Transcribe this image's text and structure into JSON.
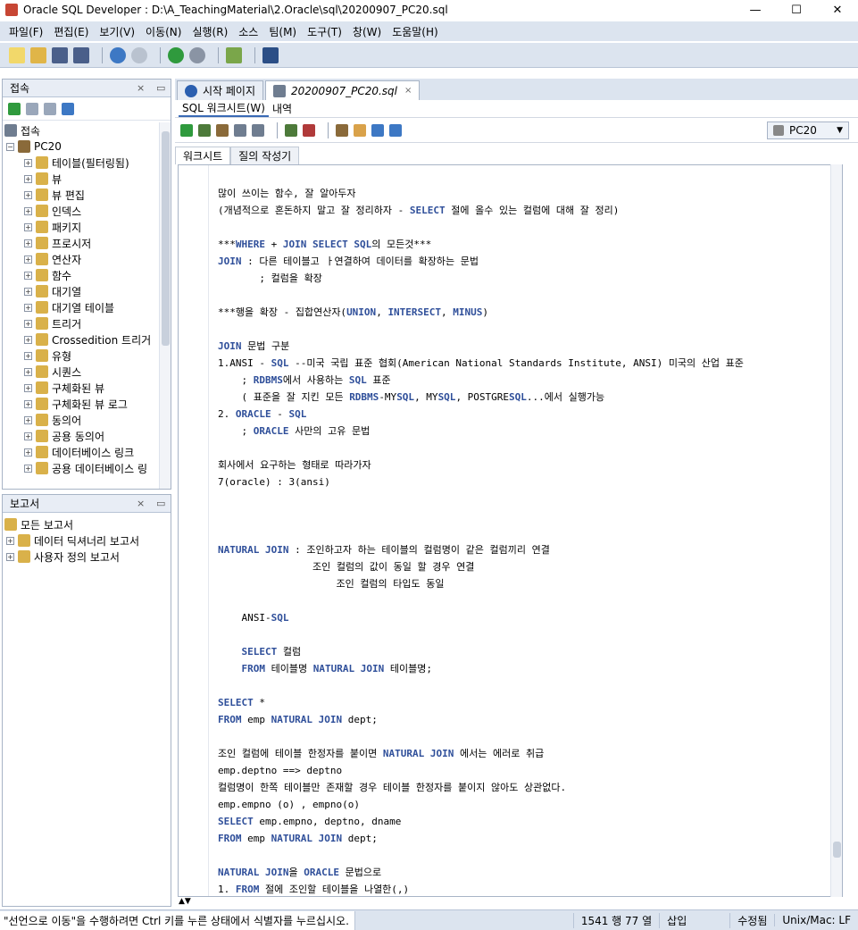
{
  "window": {
    "title": "Oracle SQL Developer : D:\\A_TeachingMaterial\\2.Oracle\\sql\\20200907_PC20.sql",
    "minimize_glyph": "—",
    "maximize_glyph": "☐",
    "close_glyph": "✕"
  },
  "menu": [
    "파일(F)",
    "편집(E)",
    "보기(V)",
    "이동(N)",
    "실행(R)",
    "소스",
    "팀(M)",
    "도구(T)",
    "창(W)",
    "도움말(H)"
  ],
  "connections_pane": {
    "title": "접속",
    "root_label": "접속",
    "connection": "PC20",
    "items": [
      "테이블(필터링됨)",
      "뷰",
      "뷰 편집",
      "인덱스",
      "패키지",
      "프로시저",
      "연산자",
      "함수",
      "대기열",
      "대기열 테이블",
      "트리거",
      "Crossedition 트리거",
      "유형",
      "시퀀스",
      "구체화된 뷰",
      "구체화된 뷰 로그",
      "동의어",
      "공용 동의어",
      "데이터베이스 링크",
      "공용 데이터베이스 링"
    ]
  },
  "reports_pane": {
    "title": "보고서",
    "root_label": "모든 보고서",
    "items": [
      "데이터 딕셔너리 보고서",
      "사용자 정의 보고서"
    ]
  },
  "doc_tabs": [
    {
      "label": "시작 페이지",
      "active": false
    },
    {
      "label": "20200907_PC20.sql",
      "active": true
    }
  ],
  "sub_tabs": [
    "SQL 워크시트(W)",
    "내역"
  ],
  "connection_select": "PC20",
  "worksheet_tabs": [
    "워크시트",
    "질의 작성기"
  ],
  "editor_lines": [
    "많이 쓰이는 함수, 잘 알아두자",
    "(개념적으로 혼돈하지 말고 잘 정리하자 - SELECT 절에 올수 있는 컬럼에 대해 잘 정리)",
    "",
    "***WHERE + JOIN SELECT SQL의 모든것***",
    "JOIN : 다른 테이블고 ㅏ연결하여 데이터를 확장하는 문법",
    "       ; 컬럼을 확장",
    "",
    "***행을 확장 - 집합연산자(UNION, INTERSECT, MINUS)",
    "",
    "JOIN 문법 구분",
    "1.ANSI - SQL --미국 국립 표준 협회(American National Standards Institute, ANSI) 미국의 산업 표준",
    "    ; RDBMS에서 사용하는 SQL 표준",
    "    ( 표준을 잘 지킨 모든 RDBMS-MYSQL, MYSQL, POSTGRESQL...에서 실행가능",
    "2. ORACLE - SQL",
    "    ; ORACLE 사만의 고유 문법",
    "",
    "회사에서 요구하는 형태로 따라가자",
    "7(oracle) : 3(ansi)",
    "",
    "",
    "",
    "NATURAL JOIN : 조인하고자 하는 테이블의 컬럼명이 같은 컬럼끼리 연결",
    "                조인 컬럼의 값이 동일 할 경우 연결",
    "                    조인 컬럼의 타입도 동일",
    "",
    "    ANSI-SQL",
    "",
    "    SELECT 컬럼",
    "    FROM 테이블명 NATURAL JOIN 테이블명;",
    "",
    "SELECT *",
    "FROM emp NATURAL JOIN dept;",
    "",
    "조인 컬럼에 테이블 한정자를 붙이면 NATURAL JOIN 에서는 에러로 취급",
    "emp.deptno ==> deptno",
    "컬럼명이 한쪽 테이블만 존재할 경우 테이블 한정자를 붙이지 않아도 상관없다.",
    "emp.empno (o) , empno(o)",
    "SELECT emp.empno, deptno, dname",
    "FROM emp NATURAL JOIN dept;",
    "",
    "NATURAL JOIN을 ORACLE 문법으로",
    "1. FROM 절에 조인할 테이블을 나열한(,)"
  ],
  "status": {
    "message": "\"선언으로 이동\"을 수행하려면 Ctrl 키를 누른 상태에서 식별자를 누르십시오.",
    "position": "1541 행 77 열",
    "mode": "삽입",
    "modified": "수정됨",
    "line_ending": "Unix/Mac: LF"
  },
  "colors": {
    "keyword": "#2f4f9a",
    "chrome": "#dce4ef"
  }
}
